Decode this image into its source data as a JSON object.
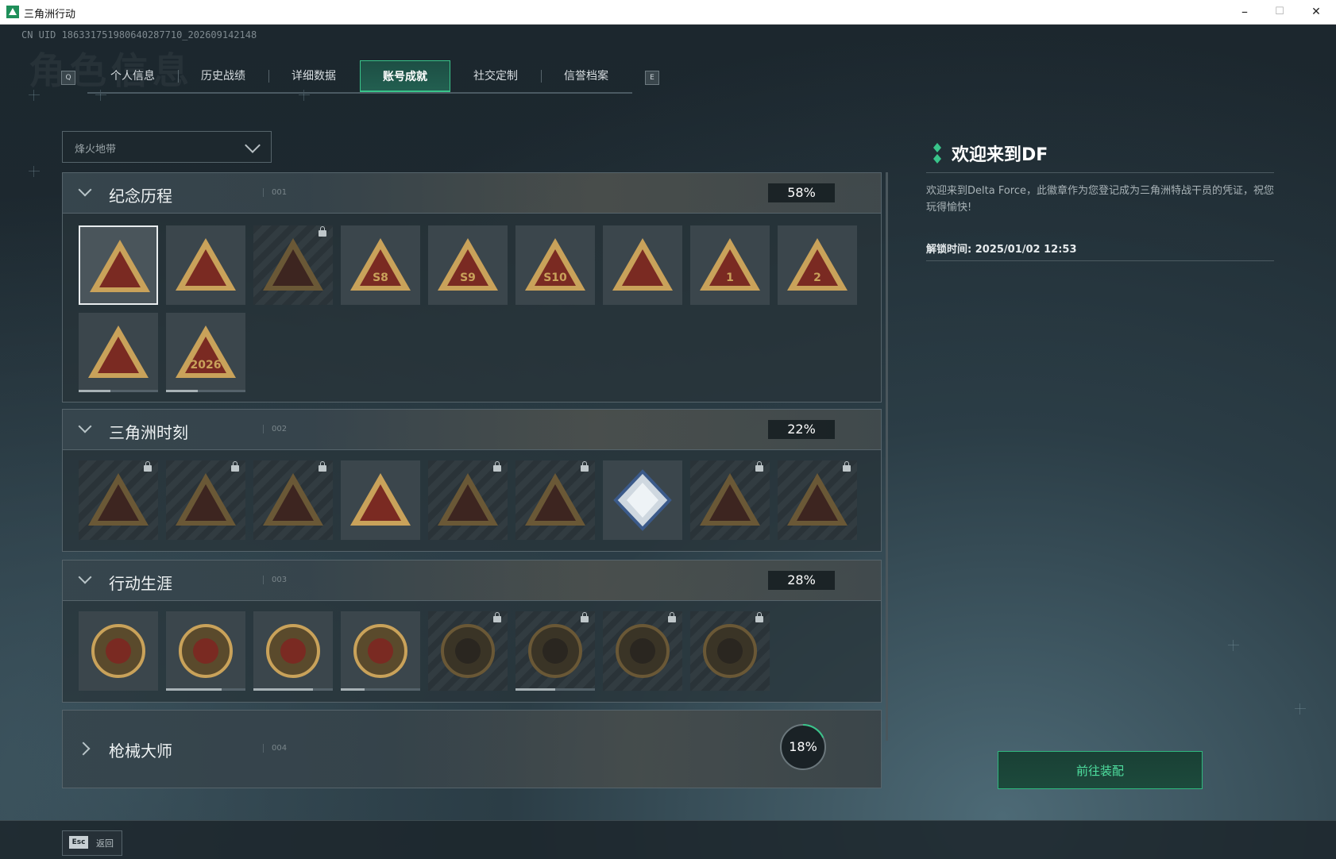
{
  "window": {
    "title": "三角洲行动",
    "minimize": "–",
    "maximize": "☐",
    "close": "✕"
  },
  "uid": "CN UID 186331751980640287710_202609142148",
  "ghost_title": "角色信息",
  "tabs": {
    "prev_key": "Q",
    "next_key": "E",
    "items": [
      {
        "label": "个人信息"
      },
      {
        "label": "历史战绩"
      },
      {
        "label": "详细数据"
      },
      {
        "label": "账号成就",
        "active": true
      },
      {
        "label": "社交定制"
      },
      {
        "label": "信誉档案"
      }
    ]
  },
  "mode_select": {
    "value": "烽火地带"
  },
  "sections": [
    {
      "title": "纪念历程",
      "index": "001",
      "percent": "58%",
      "expanded": true
    },
    {
      "title": "三角洲时刻",
      "index": "002",
      "percent": "22%",
      "expanded": true
    },
    {
      "title": "行动生涯",
      "index": "003",
      "percent": "28%",
      "expanded": true
    },
    {
      "title": "枪械大师",
      "index": "004",
      "percent": "18%",
      "percent_value": 0.18,
      "expanded": false
    }
  ],
  "badges": {
    "memorial": [
      {
        "label": "",
        "locked": false,
        "selected": true
      },
      {
        "label": "",
        "locked": false
      },
      {
        "label": "",
        "locked": true
      },
      {
        "label": "S8",
        "locked": false
      },
      {
        "label": "S9",
        "locked": false
      },
      {
        "label": "S10",
        "locked": false
      },
      {
        "label": "",
        "locked": false
      },
      {
        "label": "1",
        "locked": false
      },
      {
        "label": "2",
        "locked": false
      },
      {
        "label": "",
        "locked": false,
        "progress": 0.4
      },
      {
        "label": "2026",
        "locked": false,
        "progress": 0.4
      }
    ],
    "moments": [
      {
        "locked": true
      },
      {
        "locked": true
      },
      {
        "locked": true
      },
      {
        "locked": false
      },
      {
        "locked": true
      },
      {
        "locked": true
      },
      {
        "locked": false,
        "special": true
      },
      {
        "locked": true
      },
      {
        "locked": true
      }
    ],
    "career": [
      {
        "locked": false
      },
      {
        "locked": false,
        "progress": 0.7
      },
      {
        "locked": false,
        "progress": 0.75
      },
      {
        "locked": false,
        "progress": 0.3
      },
      {
        "locked": true
      },
      {
        "locked": true,
        "progress": 0.5
      },
      {
        "locked": true
      },
      {
        "locked": true
      }
    ]
  },
  "detail": {
    "title": "欢迎来到DF",
    "description": "欢迎来到Delta Force，此徽章作为您登记成为三角洲特战干员的凭证，祝您玩得愉快!",
    "unlock_label": "解锁时间: 2025/01/02 12:53",
    "equip_button": "前往装配"
  },
  "footer": {
    "esc_key": "Esc",
    "back_label": "返回"
  },
  "colors": {
    "accent": "#39c48a",
    "gold": "#c9a25a",
    "badge_red": "#7a2a22"
  }
}
